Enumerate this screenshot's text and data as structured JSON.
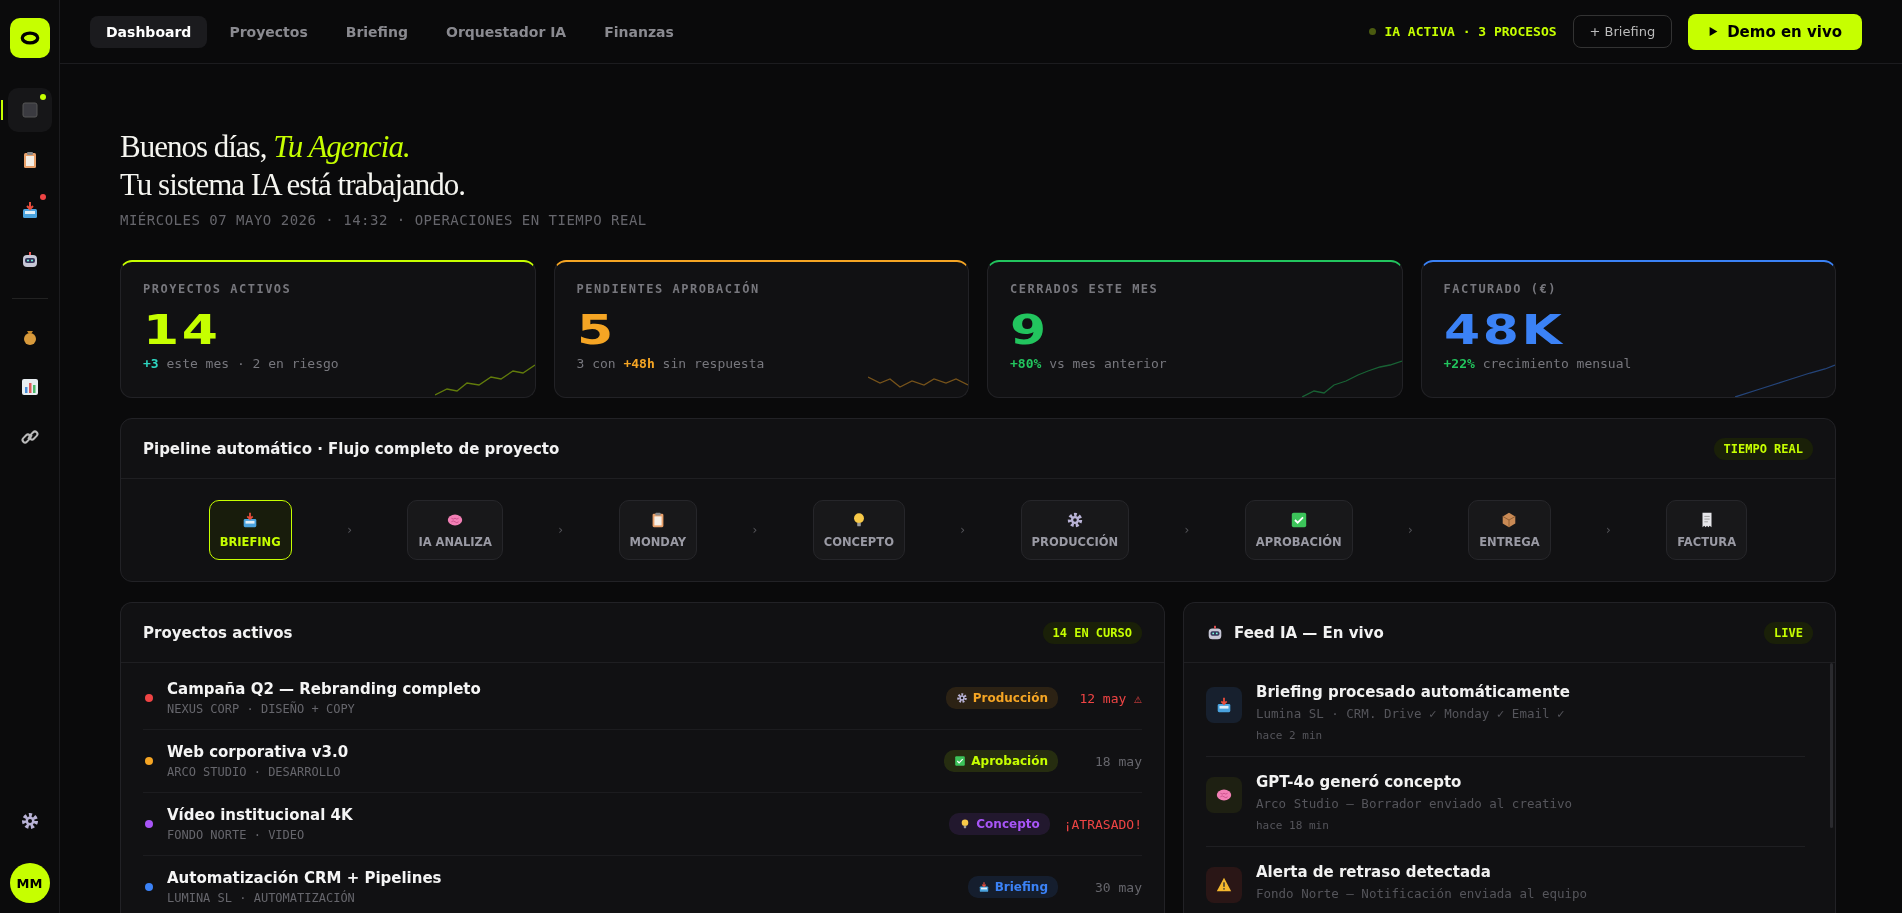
{
  "sidebar": {
    "items": [
      {
        "selected": true,
        "color": "#c6ff00"
      },
      {
        "selected": false
      },
      {
        "selected": false,
        "color": "#ef4444"
      },
      {
        "selected": false
      },
      {
        "selected": false
      },
      {
        "selected": false
      },
      {
        "selected": false
      }
    ],
    "avatar": "MM"
  },
  "nav": {
    "tabs": [
      {
        "label": "Dashboard",
        "selected": true
      },
      {
        "label": "Proyectos",
        "selected": false
      },
      {
        "label": "Briefing",
        "selected": false
      },
      {
        "label": "Orquestador IA",
        "selected": false
      },
      {
        "label": "Finanzas",
        "selected": false
      }
    ],
    "status": "IA ACTIVA · 3 PROCESOS",
    "briefing_button": "+ Briefing",
    "demo_button": "Demo en vivo"
  },
  "greeting": {
    "line1": "Buenos días, *Tu Agencia.*",
    "line2": "Tu sistema IA está trabajando.",
    "meta": "MIÉRCOLES 07 MAYO 2026 · 14:32 · OPERACIONES EN TIEMPO REAL"
  },
  "stats": [
    {
      "label": "PROYECTOS ACTIVOS",
      "value": "14",
      "color": "#c6ff00",
      "highlight": "+3",
      "kind": "neutral",
      "note": "este mes · 2 en riesgo"
    },
    {
      "label": "PENDIENTES APROBACIÓN",
      "value": "5",
      "color": "#f5a524",
      "prefix": "3 con",
      "highlight": "+48h",
      "kind": "warning",
      "note": "sin respuesta"
    },
    {
      "label": "CERRADOS ESTE MES",
      "value": "9",
      "color": "#22c55e",
      "highlight": "+80%",
      "kind": "positive",
      "note": "vs mes anterior"
    },
    {
      "label": "FACTURADO (€)",
      "value": "48K",
      "color": "#3b82f6",
      "highlight": "+22%",
      "kind": "positive",
      "note": "crecimiento mensual"
    }
  ],
  "pipeline": {
    "title": "Pipeline automático · Flujo completo de proyecto",
    "badge": "TIEMPO REAL",
    "steps": [
      {
        "label": "BRIEFING",
        "selected": true
      },
      {
        "label": "IA ANALIZA",
        "selected": false
      },
      {
        "label": "MONDAY",
        "selected": false
      },
      {
        "label": "CONCEPTO",
        "selected": false
      },
      {
        "label": "PRODUCCIÓN",
        "selected": false
      },
      {
        "label": "APROBACIÓN",
        "selected": false
      },
      {
        "label": "ENTREGA",
        "selected": false
      },
      {
        "label": "FACTURA",
        "selected": false
      }
    ],
    "separator": "›"
  },
  "projects": {
    "title": "Proyectos activos",
    "badge": "14 EN CURSO",
    "rows": [
      {
        "name": "Campaña Q2 — Rebranding completo",
        "meta": "NEXUS CORP · DISEÑO + COPY",
        "color": "#ef4444",
        "stage": "Producción",
        "kind": "production",
        "date": "12 may ⚠",
        "overdue": true
      },
      {
        "name": "Web corporativa v3.0",
        "meta": "ARCO STUDIO · DESARROLLO",
        "color": "#f5a524",
        "stage": "Aprobación",
        "kind": "approval",
        "date": "18 may",
        "overdue": false
      },
      {
        "name": "Vídeo institucional 4K",
        "meta": "FONDO NORTE · VIDEO",
        "color": "#a855f7",
        "stage": "Concepto",
        "kind": "concept",
        "date": "¡ATRASADO!",
        "overdue": true
      },
      {
        "name": "Automatización CRM + Pipelines",
        "meta": "LUMINA SL · AUTOMATIZACIÓN",
        "color": "#3b82f6",
        "stage": "Briefing",
        "kind": "briefing",
        "date": "30 may",
        "overdue": false
      }
    ]
  },
  "feed": {
    "title": "Feed IA — En vivo",
    "badge": "LIVE",
    "items": [
      {
        "kind": "inbox",
        "title": "Briefing procesado automáticamente",
        "detail": "Lumina SL · CRM. Drive ✓ Monday ✓ Email ✓",
        "time": "hace 2 min"
      },
      {
        "kind": "brain",
        "title": "GPT-4o generó concepto",
        "detail": "Arco Studio — Borrador enviado al creativo",
        "time": "hace 18 min"
      },
      {
        "kind": "alert",
        "title": "Alerta de retraso detectada",
        "detail": "Fondo Norte — Notificación enviada al equipo"
      }
    ]
  }
}
